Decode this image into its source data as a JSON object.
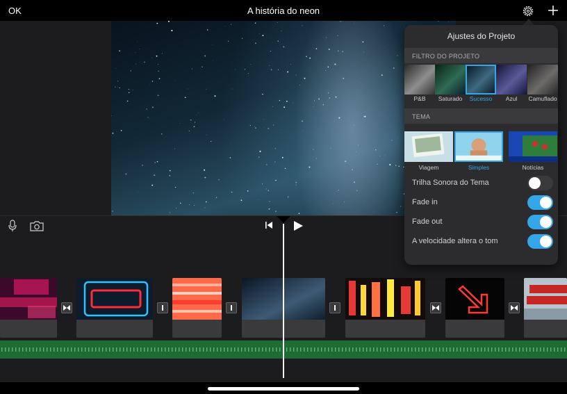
{
  "header": {
    "ok_label": "OK",
    "title": "A história do neon",
    "settings_icon": "gear-icon",
    "add_icon": "plus-icon"
  },
  "controls": {
    "mic_icon": "microphone-icon",
    "camera_icon": "camera-icon",
    "rewind_icon": "skip-back-icon",
    "play_icon": "play-icon"
  },
  "settings": {
    "title": "Ajustes do Projeto",
    "filter_section": "FILTRO DO PROJETO",
    "filters": [
      {
        "label": "P&B",
        "selected": false
      },
      {
        "label": "Saturado",
        "selected": false
      },
      {
        "label": "Sucesso",
        "selected": true
      },
      {
        "label": "Azul",
        "selected": false
      },
      {
        "label": "Camuflado",
        "selected": false
      }
    ],
    "theme_section": "TEMA",
    "themes": [
      {
        "label": "Viagem",
        "selected": false
      },
      {
        "label": "Simples",
        "selected": true
      },
      {
        "label": "Notícias",
        "selected": false
      }
    ],
    "options": [
      {
        "label": "Trilha Sonora do Tema",
        "on": false
      },
      {
        "label": "Fade in",
        "on": true
      },
      {
        "label": "Fade out",
        "on": true
      },
      {
        "label": "A velocidade altera o tom",
        "on": true
      }
    ]
  },
  "timeline": {
    "clips": [
      {
        "name": "neon-prices"
      },
      {
        "name": "open-sign"
      },
      {
        "name": "neon-stripes"
      },
      {
        "name": "milky-way"
      },
      {
        "name": "city-night"
      },
      {
        "name": "neon-arrow"
      },
      {
        "name": "market-sign"
      }
    ],
    "transition_types": [
      "cross-dissolve",
      "cut",
      "cut",
      "cut",
      "cross-dissolve",
      "cross-dissolve"
    ]
  },
  "colors": {
    "accent": "#35a7e8",
    "audio_track": "#1f6b34",
    "panel": "#2c2c2e"
  }
}
